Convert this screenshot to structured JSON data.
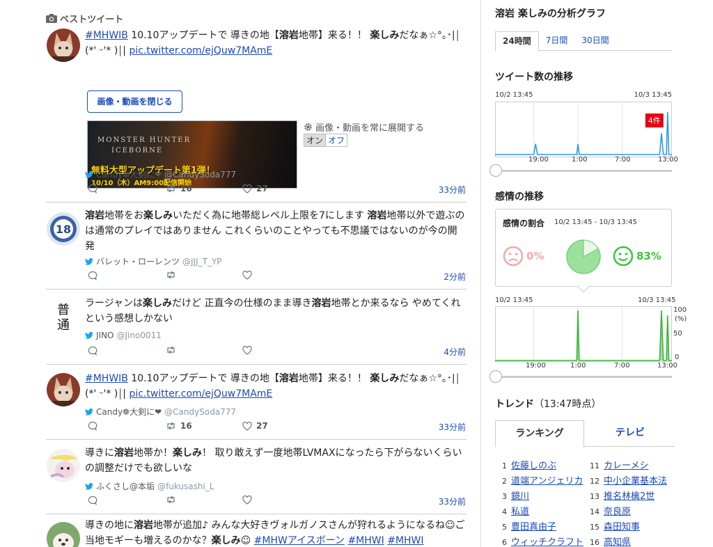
{
  "best_tweet_label": "ベストツイート",
  "tweets": [
    {
      "text_before": "",
      "tag": "#MHWIB",
      "text_html": " 10.10アップデートで 導きの地【<b>溶岩</b>地帯】来る！！ <b>楽しみ</b>だなぁ☆°｡･|￨(*' ᵕ'* )￨| ",
      "link": "pic.twitter.com/ejQuw7MAmE",
      "user_name": "Candy❁大剣に❤",
      "user_handle": "@CandySoda777",
      "retweets": "16",
      "likes": "27",
      "time": "33分前"
    },
    {
      "text_html": "<b>溶岩</b>地帯をお<b>楽しみ</b>いただく為に地帯総レベル上限を7にします <b>溶岩</b>地帯以外で遊ぶのは通常のプレイではありません これくらいのことやっても不思議ではないのが今の開発",
      "user_name": "バレット・ローレンツ",
      "user_handle": "@JJJ_T_YP",
      "retweets": "",
      "likes": "",
      "time": "2分前"
    },
    {
      "text_html": "ラージャンは<b>楽しみ</b>だけど 正直今の仕様のまま導き<b>溶岩</b>地帯とか来るなら やめてくれという感想しかない",
      "user_name": "JINO",
      "user_handle": "@Jino0011",
      "retweets": "",
      "likes": "",
      "time": "4分前"
    },
    {
      "tag": "#MHWIB",
      "text_html": " 10.10アップデートで 導きの地【<b>溶岩</b>地帯】来る！！ <b>楽しみ</b>だなぁ☆°｡･|￨(*' ᵕ'* )￨| ",
      "link": "pic.twitter.com/ejQuw7MAmE",
      "user_name": "Candy❁大剣に❤",
      "user_handle": "@CandySoda777",
      "retweets": "16",
      "likes": "27",
      "time": "33分前"
    },
    {
      "text_html": "導きに<b>溶岩</b>地帯か！<b>楽しみ</b>！ 取り敢えず一度地帯LVMAXになったら下がらないくらいの調整だけでも欲しいな",
      "user_name": "ふくさし@本垢",
      "user_handle": "@fukusashi_L",
      "retweets": "",
      "likes": "",
      "time": "33分前"
    },
    {
      "text_html": "導きの地に<b>溶岩</b>地帯が追加♪ みんな大好きヴォルガノスさんが狩れるようになるね☺ご当地モギーも増えるのかな？<b>楽しみ</b>☺ ",
      "tags_after": [
        "#MHWアイスボーン",
        "#MHWI",
        "#MHWI"
      ]
    }
  ],
  "media": {
    "close_button": "画像・動画を閉じる",
    "banner_line1": "MONSTER HUNTER",
    "banner_line2": "ICEBORNE",
    "banner_headline": "無料大型アップデート第1弾！",
    "banner_sub": "10/10（木）AM9:00配信開始",
    "expand_label": "画像・動画を常に展開する",
    "toggle_on": "オン",
    "toggle_off": "オフ"
  },
  "sidebar": {
    "title": "溶岩 楽しみの分析グラフ",
    "tabs": [
      "24時間",
      "7日間",
      "30日間"
    ],
    "tweet_count_title": "ツイート数の推移",
    "sentiment_title": "感情の推移",
    "range_start": "10/2 13:45",
    "range_end": "10/3 13:45",
    "x_ticks": [
      "19:00",
      "1:00",
      "7:00",
      "13:00"
    ],
    "peak_badge": "4件",
    "emotion_box_title": "感情の割合",
    "emotion_range": "10/2 13:45 - 10/3 13:45",
    "negative_pct": "0%",
    "positive_pct": "83%",
    "sent_y_ticks": [
      "100",
      "(%)",
      "50",
      "0"
    ]
  },
  "trends": {
    "title": "トレンド",
    "time": "（13:47時点）",
    "tab_ranking": "ランキング",
    "tab_tv": "テレビ",
    "left": [
      {
        "rank": "1",
        "name": "佐藤しのぶ"
      },
      {
        "rank": "2",
        "name": "道端アンジェリカ"
      },
      {
        "rank": "3",
        "name": "鏡川"
      },
      {
        "rank": "4",
        "name": "私道"
      },
      {
        "rank": "5",
        "name": "豊田真由子"
      },
      {
        "rank": "6",
        "name": "ウィッチクラフト"
      }
    ],
    "right": [
      {
        "rank": "11",
        "name": "カレーメシ"
      },
      {
        "rank": "12",
        "name": "中小企業基本法"
      },
      {
        "rank": "13",
        "name": "推名林檎2世"
      },
      {
        "rank": "14",
        "name": "奈良原"
      },
      {
        "rank": "15",
        "name": "森田知事"
      },
      {
        "rank": "16",
        "name": "高知県"
      }
    ]
  },
  "colors": {
    "link": "#1a4ab8",
    "tweet_line": "#2b9be8",
    "sentiment_line": "#3cb43c",
    "sentiment_fill": "#9be09b",
    "peak_badge": "#e60012",
    "negative": "#f5a8a8",
    "positive": "#3cc43c"
  },
  "chart_data": [
    {
      "type": "line",
      "title": "ツイート数の推移",
      "x_range": [
        "10/2 13:45",
        "10/3 13:45"
      ],
      "x_ticks": [
        "19:00",
        "1:00",
        "7:00",
        "13:00"
      ],
      "peak_label": "4件",
      "series": [
        {
          "x": [
            "10/2 13:45",
            "10/2 19:00",
            "10/2 19:15",
            "10/2 19:30",
            "10/3 0:50",
            "10/3 1:00",
            "10/3 1:10",
            "10/3 12:05",
            "10/3 12:20",
            "10/3 12:35",
            "10/3 13:00",
            "10/3 13:10",
            "10/3 13:20",
            "10/3 13:45"
          ],
          "values": [
            0,
            0,
            1,
            0,
            0,
            1,
            0,
            0,
            2,
            0,
            0,
            4,
            0,
            0
          ]
        }
      ]
    },
    {
      "type": "area",
      "title": "感情の推移",
      "x_range": [
        "10/2 13:45",
        "10/3 13:45"
      ],
      "x_ticks": [
        "19:00",
        "1:00",
        "7:00",
        "13:00"
      ],
      "ylabel": "(%)",
      "ylim": [
        0,
        100
      ],
      "series": [
        {
          "x": [
            "10/2 13:45",
            "10/3 0:50",
            "10/3 1:00",
            "10/3 1:10",
            "10/3 12:05",
            "10/3 12:20",
            "10/3 12:35",
            "10/3 13:00",
            "10/3 13:10",
            "10/3 13:20",
            "10/3 13:45"
          ],
          "values": [
            0,
            0,
            100,
            0,
            0,
            100,
            0,
            0,
            90,
            0,
            0
          ]
        }
      ]
    },
    {
      "type": "pie",
      "title": "感情の割合",
      "categories": [
        "ポジティブ",
        "ネガティブ",
        "ニュートラル"
      ],
      "values": [
        83,
        0,
        17
      ]
    }
  ]
}
